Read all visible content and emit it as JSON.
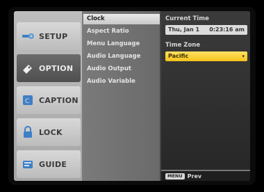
{
  "categories": [
    {
      "label": "SETUP",
      "icon": "wrench-icon",
      "selected": false
    },
    {
      "label": "OPTION",
      "icon": "option-icon",
      "selected": true
    },
    {
      "label": "CAPTION",
      "icon": "caption-icon",
      "selected": false
    },
    {
      "label": "LOCK",
      "icon": "lock-icon",
      "selected": false
    },
    {
      "label": "GUIDE",
      "icon": "guide-icon",
      "selected": false
    }
  ],
  "menu": {
    "items": [
      {
        "label": "Clock",
        "selected": true
      },
      {
        "label": "Aspect Ratio",
        "selected": false
      },
      {
        "label": "Menu Language",
        "selected": false
      },
      {
        "label": "Audio Language",
        "selected": false
      },
      {
        "label": "Audio Output",
        "selected": false
      },
      {
        "label": "Audio Variable",
        "selected": false
      }
    ]
  },
  "detail": {
    "current_time_label": "Current Time",
    "current_date": "Thu, Jan 1",
    "current_time": "0:23:16 am",
    "time_zone_label": "Time Zone",
    "time_zone_value": "Pacific",
    "dropdown_arrow": "▾"
  },
  "footer": {
    "back_button": "MENU",
    "back_label": "Prev"
  },
  "colors": {
    "accent": "#f5c21a",
    "selected_category": "#5a5a5a"
  }
}
